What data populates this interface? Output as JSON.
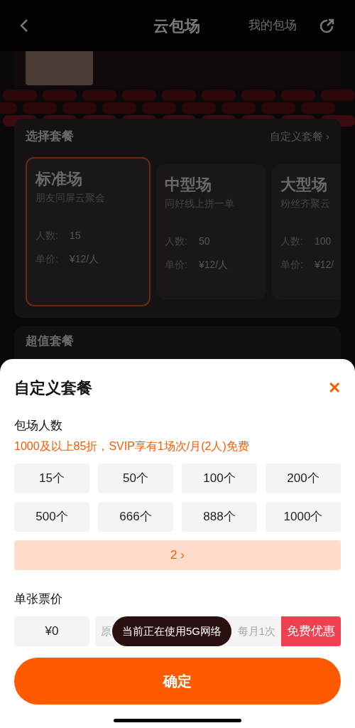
{
  "header": {
    "title": "云包场",
    "action": "我的包场"
  },
  "package_section": {
    "title": "选择套餐",
    "link": "自定义套餐 ›",
    "packages": [
      {
        "name": "标准场",
        "tagline": "朋友同屏云聚会",
        "count_label": "人数:",
        "count": "15",
        "price_label": "单价:",
        "price": "¥12/人",
        "selected": true
      },
      {
        "name": "中型场",
        "tagline": "同好线上拼一单",
        "count_label": "人数:",
        "count": "50",
        "price_label": "单价:",
        "price": "¥12/人",
        "selected": false
      },
      {
        "name": "大型场",
        "tagline": "粉丝齐聚云",
        "count_label": "人数:",
        "count": "100",
        "price_label": "单价:",
        "price": "¥12/",
        "selected": false
      }
    ]
  },
  "value_section": {
    "title": "超值套餐"
  },
  "sheet": {
    "title": "自定义套餐",
    "close": "✕",
    "people_label": "包场人数",
    "promo": "1000及以上85折，SVIP享有1场次/月(2人)免费",
    "options": [
      {
        "label": "15个",
        "selected": false
      },
      {
        "label": "50个",
        "selected": false
      },
      {
        "label": "100个",
        "selected": false
      },
      {
        "label": "200个",
        "selected": false
      },
      {
        "label": "500个",
        "selected": false
      },
      {
        "label": "666个",
        "selected": false
      },
      {
        "label": "888个",
        "selected": false
      },
      {
        "label": "1000个",
        "selected": false
      }
    ],
    "more": "2 ›",
    "price_label": "单张票价",
    "price_value": "¥0",
    "price_note_start": "原",
    "price_note_end": "每月1次",
    "badge": "免费优惠",
    "confirm": "确定"
  },
  "toast": "当前正在使用5G网络"
}
